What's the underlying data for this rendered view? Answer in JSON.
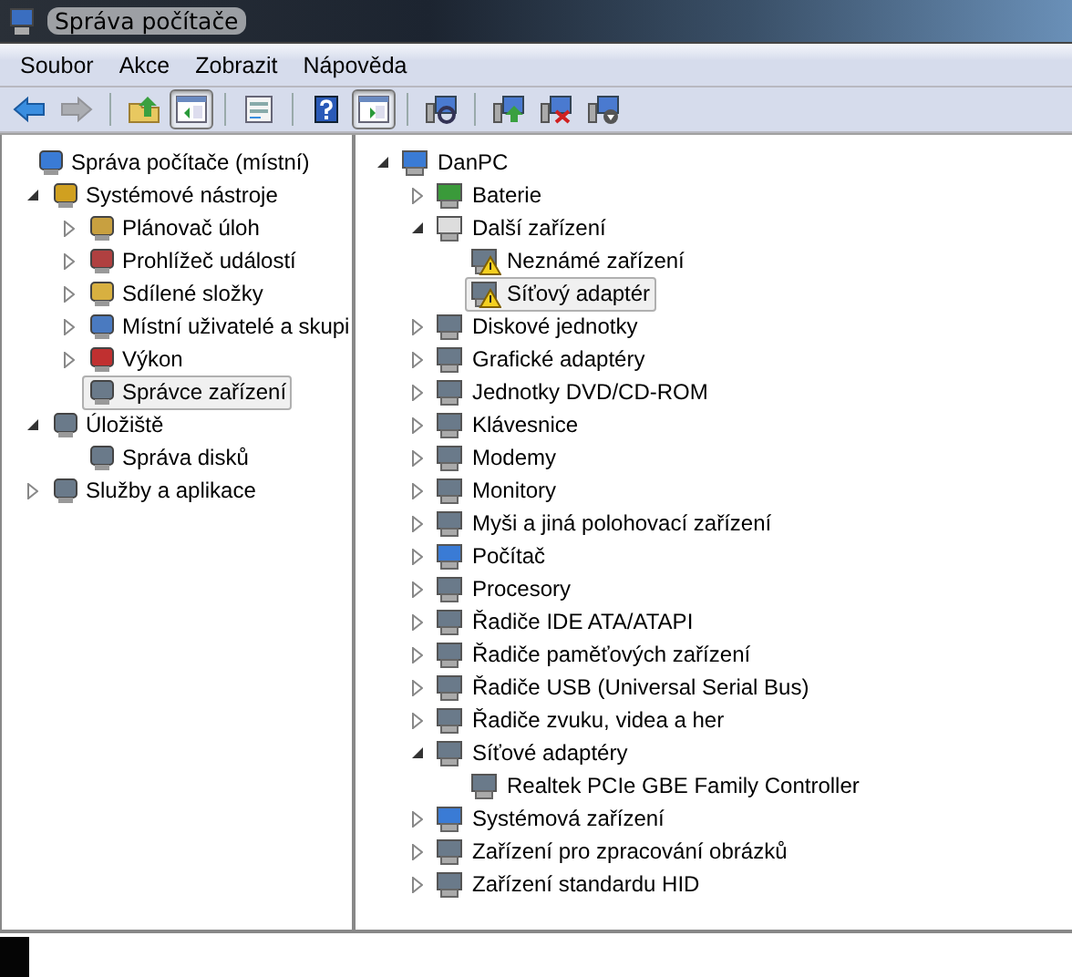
{
  "window": {
    "title": "Správa počítače"
  },
  "menu": [
    "Soubor",
    "Akce",
    "Zobrazit",
    "Nápověda"
  ],
  "toolbar": [
    [
      {
        "pressed": false,
        "disabled": false
      },
      {
        "pressed": false,
        "disabled": true
      }
    ],
    [
      {
        "pressed": false,
        "disabled": false
      },
      {
        "pressed": true,
        "disabled": false
      }
    ],
    [
      {
        "pressed": false,
        "disabled": false
      }
    ],
    [
      {
        "pressed": false,
        "disabled": false
      },
      {
        "pressed": true,
        "disabled": false
      }
    ],
    [
      {
        "pressed": false,
        "disabled": false
      }
    ],
    [
      {
        "pressed": false,
        "disabled": false
      },
      {
        "pressed": false,
        "disabled": false
      },
      {
        "pressed": false,
        "disabled": false
      }
    ]
  ],
  "console_tree": [
    {
      "label": "Správa počítače (místní)",
      "selected": false,
      "children": [
        {
          "label": "Systémové nástroje",
          "expanded": true,
          "selected": false,
          "children": [
            {
              "label": "Plánovač úloh",
              "expanded": false,
              "selected": false
            },
            {
              "label": "Prohlížeč událostí",
              "expanded": false,
              "selected": false
            },
            {
              "label": "Sdílené složky",
              "expanded": false,
              "selected": false
            },
            {
              "label": "Místní uživatelé a skupi",
              "expanded": false,
              "selected": false
            },
            {
              "label": "Výkon",
              "expanded": false,
              "selected": false
            },
            {
              "label": "Správce zařízení",
              "selected": true
            }
          ]
        },
        {
          "label": "Úložiště",
          "expanded": true,
          "selected": false,
          "children": [
            {
              "label": "Správa disků",
              "selected": false
            }
          ]
        },
        {
          "label": "Služby a aplikace",
          "expanded": false,
          "selected": false
        }
      ]
    }
  ],
  "device_tree": [
    {
      "label": "DanPC",
      "expanded": true,
      "selected": false,
      "children": [
        {
          "label": "Baterie",
          "expanded": false,
          "selected": false
        },
        {
          "label": "Další zařízení",
          "expanded": true,
          "selected": false,
          "children": [
            {
              "label": "Neznámé zařízení",
              "selected": false,
              "warning": true
            },
            {
              "label": "Síťový adaptér",
              "selected": true,
              "warning": true
            }
          ]
        },
        {
          "label": "Diskové jednotky",
          "expanded": false,
          "selected": false
        },
        {
          "label": "Grafické adaptéry",
          "expanded": false,
          "selected": false
        },
        {
          "label": "Jednotky DVD/CD-ROM",
          "expanded": false,
          "selected": false
        },
        {
          "label": "Klávesnice",
          "expanded": false,
          "selected": false
        },
        {
          "label": "Modemy",
          "expanded": false,
          "selected": false
        },
        {
          "label": "Monitory",
          "expanded": false,
          "selected": false
        },
        {
          "label": "Myši a jiná polohovací zařízení",
          "expanded": false,
          "selected": false
        },
        {
          "label": "Počítač",
          "expanded": false,
          "selected": false
        },
        {
          "label": "Procesory",
          "expanded": false,
          "selected": false
        },
        {
          "label": "Řadiče IDE ATA/ATAPI",
          "expanded": false,
          "selected": false
        },
        {
          "label": "Řadiče paměťových zařízení",
          "expanded": false,
          "selected": false
        },
        {
          "label": "Řadiče USB (Universal Serial Bus)",
          "expanded": false,
          "selected": false
        },
        {
          "label": "Řadiče zvuku, videa a her",
          "expanded": false,
          "selected": false
        },
        {
          "label": "Síťové adaptéry",
          "expanded": true,
          "selected": false,
          "children": [
            {
              "label": "Realtek PCIe GBE Family Controller",
              "selected": false,
              "warning": false
            }
          ]
        },
        {
          "label": "Systémová zařízení",
          "expanded": false,
          "selected": false
        },
        {
          "label": "Zařízení pro zpracování obrázků",
          "expanded": false,
          "selected": false
        },
        {
          "label": "Zařízení standardu HID",
          "expanded": false,
          "selected": false
        }
      ]
    }
  ]
}
